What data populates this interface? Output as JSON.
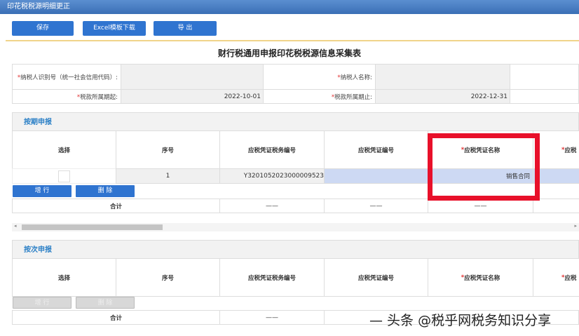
{
  "window_title": "印花税税源明细更正",
  "toolbar": {
    "save": "保存",
    "excel": "Excel模板下载",
    "export": "导 出"
  },
  "page_title": "财行税通用申报印花税税源信息采集表",
  "info": {
    "taxpayer_id_label": "纳税人识别号（统一社会信用代码）:",
    "taxpayer_name_label": "纳税人名称:",
    "period_start_label": "税款所属期起:",
    "period_start": "2022-10-01",
    "period_end_label": "税款所属期止:",
    "period_end": "2022-12-31",
    "required_mark": "*"
  },
  "periodic": {
    "title": "按期申报",
    "columns": [
      "选择",
      "序号",
      "应税凭证税务编号",
      "应税凭证编号",
      "*应税凭证名称",
      "*应税"
    ],
    "rows": [
      {
        "index": "1",
        "tax_no": "Y3201052023000009523",
        "voucher_no": "",
        "voucher_name": "销售合同"
      }
    ],
    "add_row": "增 行",
    "delete": "删 除",
    "total_label": "合计",
    "dash": "——"
  },
  "per_time": {
    "title": "按次申报",
    "columns": [
      "选择",
      "序号",
      "应税凭证税务编号",
      "应税凭证编号",
      "*应税凭证名称",
      "*应税"
    ],
    "add_row": "增 行",
    "delete": "删 除",
    "total_label": "合计",
    "dash": "——"
  },
  "watermark": "— 头条 @税乎网税务知识分享"
}
